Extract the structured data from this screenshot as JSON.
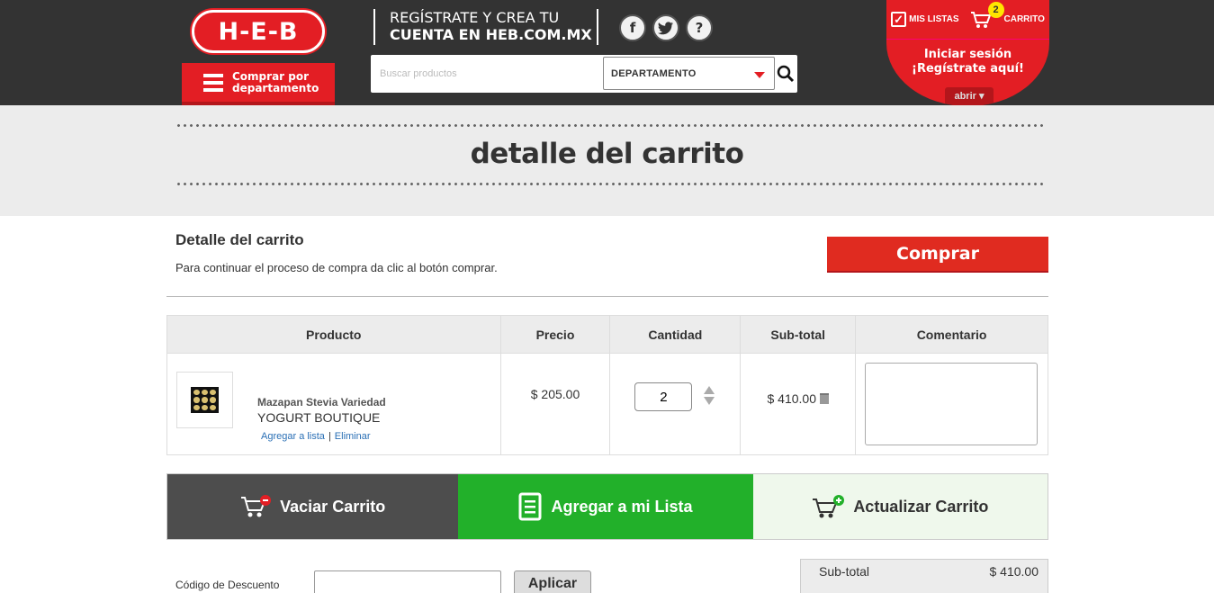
{
  "header": {
    "logo_text": "H-E-B",
    "dept_button": "Comprar por departamento",
    "promo_line1": "REGÍSTRATE Y CREA TU",
    "promo_line2": "CUENTA EN HEB.COM.MX",
    "social": {
      "facebook": "f",
      "twitter": "t",
      "help": "?"
    },
    "search_placeholder": "Buscar productos",
    "dept_select": "DEPARTAMENTO",
    "mis_listas": "MIS LISTAS",
    "cart_label": "CARRITO",
    "cart_count": "2",
    "login_line1": "Iniciar sesión",
    "login_line2": "¡Regístrate aquí!",
    "abrir": "abrir"
  },
  "banner": {
    "title": "detalle del carrito"
  },
  "detail": {
    "title": "Detalle del carrito",
    "subtitle": "Para continuar el proceso de compra da clic al botón comprar.",
    "comprar": "Comprar"
  },
  "table": {
    "headers": [
      "Producto",
      "Precio",
      "Cantidad",
      "Sub-total",
      "Comentario"
    ],
    "rows": [
      {
        "name": "Mazapan Stevia Variedad",
        "brand": "YOGURT BOUTIQUE",
        "link_add": "Agregar a lista",
        "link_remove": "Eliminar",
        "price": "$ 205.00",
        "qty": "2",
        "subtotal": "$ 410.00",
        "comment": ""
      }
    ]
  },
  "actions": {
    "vaciar": "Vaciar Carrito",
    "lista": "Agregar a mi Lista",
    "actualizar": "Actualizar Carrito"
  },
  "discount": {
    "label": "Código de Descuento",
    "apply": "Aplicar"
  },
  "summary": {
    "label": "Sub-total",
    "value": "$ 410.00"
  },
  "colors": {
    "brand_red": "#e31e24",
    "green": "#22b02a",
    "dark": "#333333"
  }
}
